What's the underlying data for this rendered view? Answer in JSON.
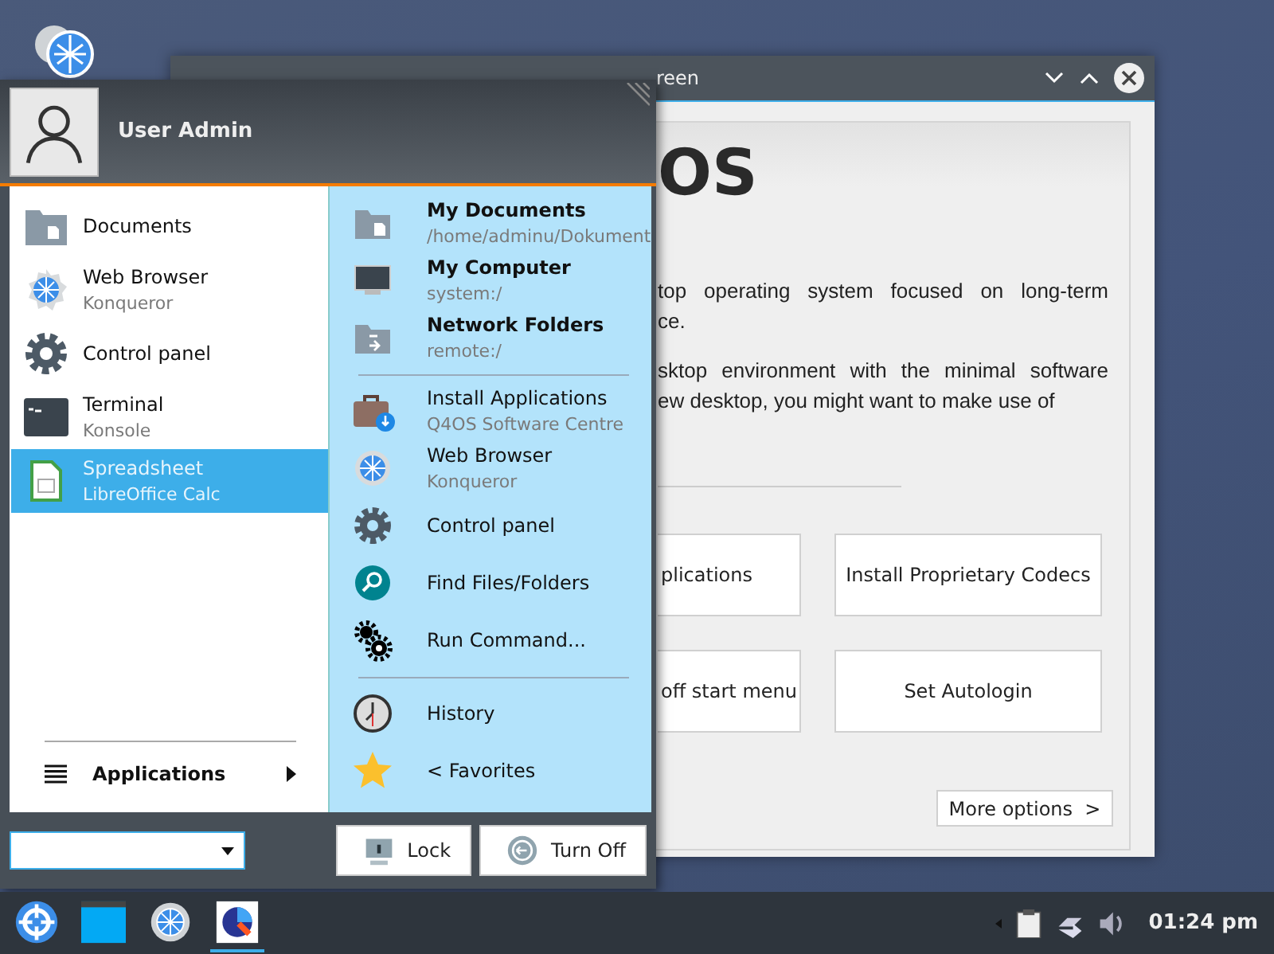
{
  "window": {
    "title": "reen",
    "heading": "OS",
    "paragraphs": [
      {
        "lines": [
          "top operating system focused on long-term",
          "ce."
        ]
      },
      {
        "lines": [
          "sktop environment with the minimal software",
          "ew desktop, you might want to make use of"
        ]
      }
    ],
    "buttons": [
      "plications",
      "Install Proprietary Codecs",
      "off start menu",
      "Set Autologin"
    ],
    "more_button": "More options  >"
  },
  "start_menu": {
    "user": "User Admin",
    "recent": [
      {
        "name": "Documents",
        "selected": false
      },
      {
        "name": "Web Browser",
        "subtitle": "Konqueror",
        "selected": false
      },
      {
        "name": "Control panel",
        "selected": false
      },
      {
        "name": "Terminal",
        "subtitle": "Konsole",
        "selected": false
      },
      {
        "name": "Spreadsheet",
        "subtitle": "LibreOffice Calc",
        "selected": true
      }
    ],
    "applications": "Applications",
    "places": [
      {
        "kind": "place",
        "name": "My Documents",
        "subtitle": "/home/adminu/Dokument"
      },
      {
        "kind": "place",
        "name": "My Computer",
        "subtitle": "system:/"
      },
      {
        "kind": "place",
        "name": "Network Folders",
        "subtitle": "remote:/"
      },
      {
        "kind": "separator"
      },
      {
        "kind": "app",
        "name": "Install Applications",
        "subtitle": "Q4OS Software Centre"
      },
      {
        "kind": "app",
        "name": "Web Browser",
        "subtitle": "Konqueror"
      },
      {
        "kind": "app",
        "name": "Control panel"
      },
      {
        "kind": "app",
        "name": "Find Files/Folders"
      },
      {
        "kind": "app",
        "name": "Run Command..."
      },
      {
        "kind": "separator"
      },
      {
        "kind": "app",
        "name": "History"
      },
      {
        "kind": "app",
        "name": "<  Favorites"
      }
    ],
    "buttons": [
      "Lock",
      "Turn Off"
    ]
  },
  "taskbar": {
    "launchers": [
      {
        "active": false
      },
      {
        "active": false
      },
      {
        "active": false
      },
      {
        "active": true
      }
    ],
    "clock": "01:24 pm"
  }
}
